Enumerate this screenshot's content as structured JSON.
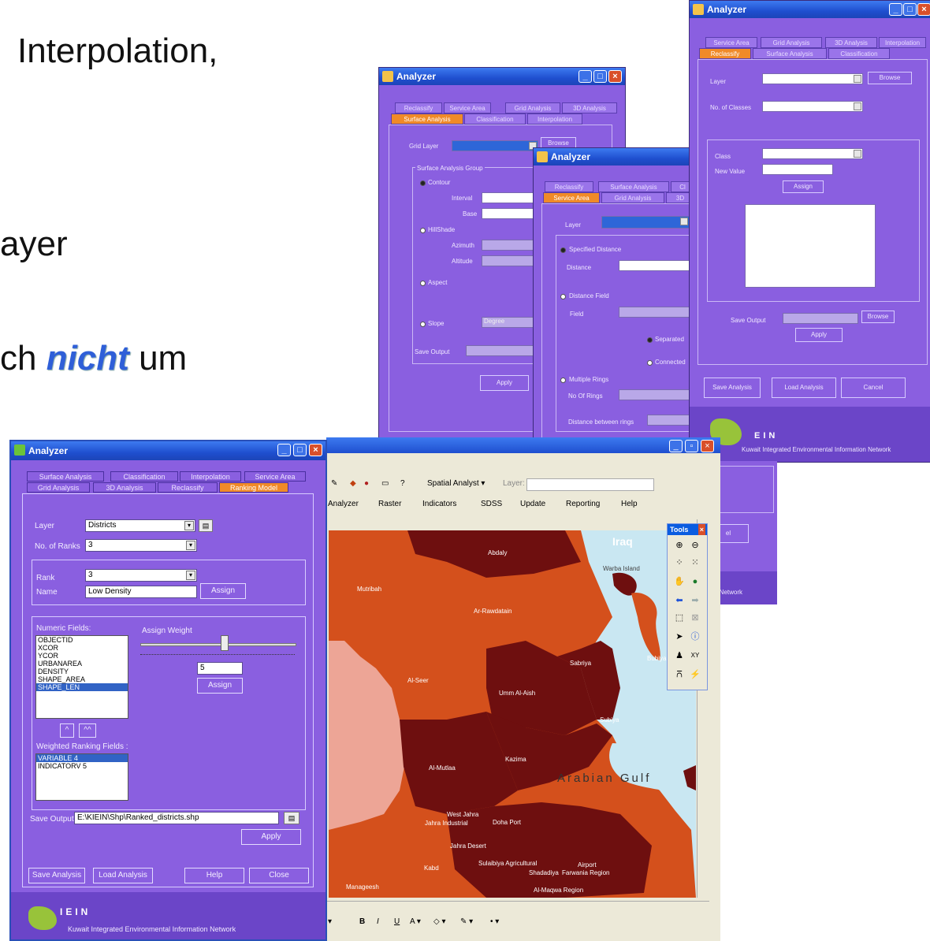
{
  "slide": {
    "line1": "Interpolation,",
    "line2": "ayer",
    "line3_prefix": "ch",
    "line3_emph": "nicht",
    "line3_suffix": "um"
  },
  "bg_win_surface": {
    "title": "Analyzer",
    "tabs_row1": [
      "Reclassify",
      "Service Area",
      "Grid Analysis",
      "3D Analysis"
    ],
    "tabs_row2": [
      "Surface Analysis",
      "Classification",
      "Interpolation"
    ],
    "grid_layer_label": "Grid Layer",
    "browse": "Browse",
    "group_title": "Surface Analysis Group",
    "contour": "Contour",
    "interval": "Interval",
    "base": "Base",
    "hillshade": "HillShade",
    "azimuth": "Azimuth",
    "altitude": "Altitude",
    "aspect": "Aspect",
    "slope": "Slope",
    "degree": "Degree",
    "save_output": "Save Output",
    "apply": "Apply"
  },
  "bg_win_service": {
    "title": "Analyzer",
    "tabs_row1": [
      "Reclassify",
      "Surface Analysis",
      "Cl"
    ],
    "tabs_row2": [
      "Service Area",
      "Grid Analysis",
      "3D"
    ],
    "layer": "Layer",
    "specified_distance": "Specified Distance",
    "distance": "Distance",
    "distance_field": "Distance Field",
    "field": "Field",
    "separated": "Separated",
    "connected": "Connected",
    "multiple_rings": "Multiple Rings",
    "no_of_rings": "No Of Rings",
    "distance_between_rings": "Distance between rings"
  },
  "bg_win_reclass": {
    "title": "Analyzer",
    "tabs_row1": [
      "Service Area",
      "Grid Analysis",
      "3D Analysis",
      "Interpolation"
    ],
    "tabs_row2": [
      "Reclassify",
      "Surface Analysis",
      "Classification"
    ],
    "layer": "Layer",
    "browse": "Browse",
    "no_of_classes": "No. of Classes",
    "class": "Class",
    "new_value": "New Value",
    "assign": "Assign",
    "save_output": "Save Output",
    "browse2": "Browse",
    "apply": "Apply",
    "save_analysis": "Save Analysis",
    "load_analysis": "Load Analysis",
    "cancel": "Cancel",
    "footer": "Kuwait Integrated Environmental Information Network",
    "logo": "EIN"
  },
  "peek_win": {
    "network": "n Network",
    "partial_btn": "el"
  },
  "main": {
    "title": "Analyzer",
    "tabs_row1": [
      "Surface Analysis",
      "Classification",
      "Interpolation",
      "Service Area"
    ],
    "tabs_row2": [
      "Grid Analysis",
      "3D Analysis",
      "Reclassify",
      "Ranking Model"
    ],
    "layer_label": "Layer",
    "layer_value": "Districts",
    "ranks_label": "No. of Ranks",
    "ranks_value": "3",
    "rank_label": "Rank",
    "rank_value": "3",
    "name_label": "Name",
    "name_value": "Low Density",
    "assign": "Assign",
    "numeric_fields_label": "Numeric Fields:",
    "numeric_fields": [
      "OBJECTID",
      "XCOR",
      "YCOR",
      "URBANAREA",
      "DENSITY",
      "SHAPE_AREA",
      "SHAPE_LEN"
    ],
    "assign_weight_label": "Assign Weight",
    "weight_value": "5",
    "weight_level": 0.55,
    "assign2": "Assign",
    "up1": "^",
    "up2": "^^",
    "weighted_label": "Weighted Ranking Fields :",
    "weighted_fields": [
      "VARIABLE 4",
      "INDICATORV 5"
    ],
    "save_output_label": "Save Output",
    "save_output_value": "E:\\KIEIN\\Shp\\Ranked_districts.shp",
    "apply": "Apply",
    "save_analysis": "Save Analysis",
    "load_analysis": "Load Analysis",
    "help": "Help",
    "close": "Close",
    "logo": "IEIN",
    "footer": "Kuwait Integrated Environmental Information Network"
  },
  "map": {
    "spatial_analyst": "Spatial Analyst",
    "layer_label": "Layer:",
    "menu": [
      "Analyzer",
      "Raster",
      "Indicators",
      "SDSS",
      "Update",
      "Reporting",
      "Help"
    ],
    "tools_title": "Tools",
    "labels": {
      "iraq": "Iraq",
      "abdaly": "Abdaly",
      "warba": "Warba Island",
      "mutribah": "Mutribah",
      "rawdatain": "Ar-Rawdatain",
      "sabriya": "Sabriya",
      "bubiyan": "Bubiya",
      "seer": "Al-Seer",
      "umm_al_aish": "Umm Al-Aish",
      "subiya": "Subiya",
      "kazima": "Kazima",
      "mutlaa": "Al-Mutlaa",
      "gulf": "Arabian Gulf",
      "west_jahra": "West Jahra",
      "jahra_industrial": "Jahra Industrial",
      "doha_port": "Doha Port",
      "jahra_desert": "Jahra Desert",
      "sulaibiya_agri": "Sulaibiya Agricultural",
      "kabd": "Kabd",
      "manageesh": "Manageesh",
      "shadadiya": "Shadadiya",
      "farwania": "Farwania Region",
      "airport": "Airport",
      "magwa": "Al-Maqwa Region"
    }
  },
  "colors": {
    "purple": "#8a5fe0",
    "orange_tab": "#f08a28",
    "dark_district": "#6e0f0f",
    "orange_district": "#d4501c",
    "pink_district": "#eda596",
    "sea": "#c9e7f2"
  }
}
